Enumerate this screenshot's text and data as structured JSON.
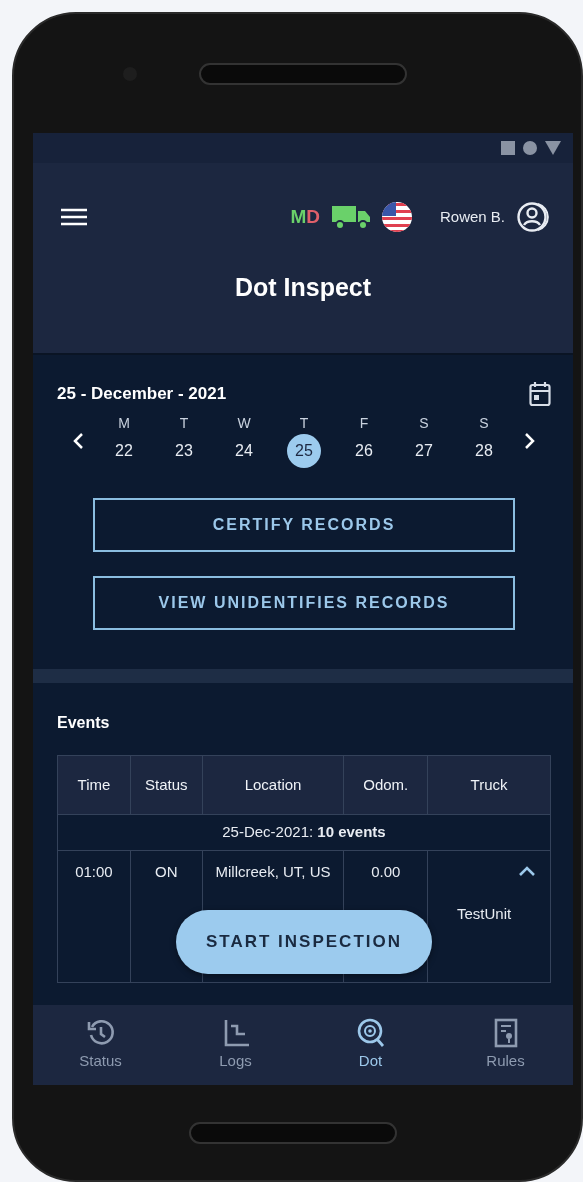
{
  "header": {
    "status_letters": [
      {
        "text": "M",
        "color": "#6ad16a"
      },
      {
        "text": "D",
        "color": "#e0606a"
      }
    ],
    "user_name": "Rowen B.",
    "title": "Dot Inspect"
  },
  "calendar": {
    "date_label": "25 - December - 2021",
    "days": [
      {
        "weekday": "M",
        "date": "22",
        "selected": false
      },
      {
        "weekday": "T",
        "date": "23",
        "selected": false
      },
      {
        "weekday": "W",
        "date": "24",
        "selected": false
      },
      {
        "weekday": "T",
        "date": "25",
        "selected": true
      },
      {
        "weekday": "F",
        "date": "26",
        "selected": false
      },
      {
        "weekday": "S",
        "date": "27",
        "selected": false
      },
      {
        "weekday": "S",
        "date": "28",
        "selected": false
      }
    ],
    "buttons": [
      "CERTIFY RECORDS",
      "VIEW UNIDENTIFIES RECORDS"
    ]
  },
  "events": {
    "title": "Events",
    "columns": [
      "Time",
      "Status",
      "Location",
      "Odom.",
      "Truck"
    ],
    "group_label": "25-Dec-2021: **10 events**",
    "rows": [
      {
        "time": "01:00",
        "status": "ON",
        "location": "Millcreek, UT, US",
        "odometer": "0.00",
        "truck": "TestUnit",
        "expanded": true
      }
    ]
  },
  "action_button": "START INSPECTION",
  "nav": [
    {
      "label": "Status",
      "selected": false
    },
    {
      "label": "Logs",
      "selected": false
    },
    {
      "label": "Dot",
      "selected": true
    },
    {
      "label": "Rules",
      "selected": false
    }
  ]
}
